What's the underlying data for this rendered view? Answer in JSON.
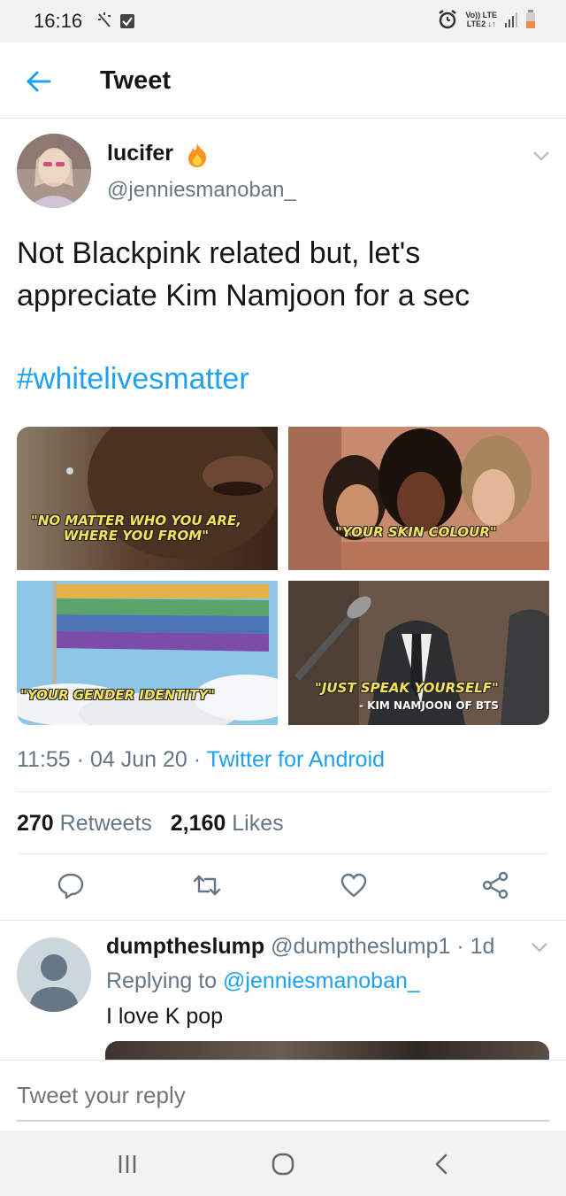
{
  "status_bar": {
    "time": "16:16",
    "network_line1": "Vo)) LTE",
    "network_line2": "LTE2 ↓↑"
  },
  "header": {
    "title": "Tweet",
    "back_icon": "arrow-left-icon"
  },
  "tweet": {
    "display_name": "lucifer",
    "badge_icon": "fire-emoji",
    "handle": "@jenniesmanoban_",
    "text": "Not Blackpink related but, let's appreciate Kim Namjoon for a sec",
    "hashtag": "#whitelivesmatter",
    "media": [
      {
        "caption_line1": "\"NO MATTER WHO YOU ARE,",
        "caption_line2": "WHERE YOU FROM\""
      },
      {
        "caption_line1": "\"YOUR SKIN COLOUR\""
      },
      {
        "caption_line1": "\"YOUR GENDER IDENTITY\""
      },
      {
        "caption_line1": "\"JUST SPEAK YOURSELF\"",
        "caption_sub": "- KIM NAMJOON OF BTS"
      }
    ],
    "time": "11:55",
    "date": "04 Jun 20",
    "source": "Twitter for Android",
    "retweets_count": "270",
    "retweets_label": "Retweets",
    "likes_count": "2,160",
    "likes_label": "Likes",
    "accent_color": "#1da1f2"
  },
  "reply": {
    "display_name": "dumptheslump",
    "handle": "@dumptheslump1",
    "age": "1d",
    "replying_prefix": "Replying to",
    "replying_to": "@jenniesmanoban_",
    "text": "I love K pop"
  },
  "compose": {
    "placeholder": "Tweet your reply"
  }
}
